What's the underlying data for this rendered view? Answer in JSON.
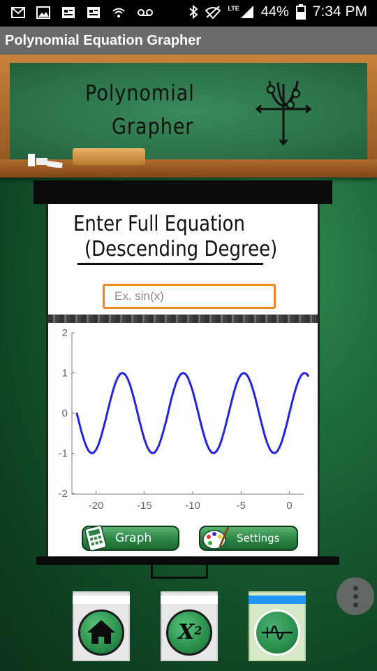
{
  "status_bar": {
    "battery": "44%",
    "time": "7:34 PM",
    "signal_label": "LTE",
    "notification_icons": [
      "gmail-icon",
      "gallery-icon",
      "news-icon",
      "news-icon",
      "wifi-icon",
      "voicemail-icon"
    ]
  },
  "app_bar": {
    "title": "Polynomial Equation Grapher"
  },
  "chalkboard": {
    "line1": "Polynomial",
    "line2": "Grapher"
  },
  "screen": {
    "prompt_line1": "Enter Full Equation",
    "prompt_line2": "(Descending Degree)",
    "input_placeholder": "Ex. sin(x)",
    "input_value": ""
  },
  "chart_data": {
    "type": "line",
    "function": "sin",
    "x": [
      -22.0,
      -21.75,
      -21.5,
      -21.25,
      -21.0,
      -20.75,
      -20.5,
      -20.25,
      -20.0,
      -19.75,
      -19.5,
      -19.25,
      -19.0,
      -18.75,
      -18.5,
      -18.25,
      -18.0,
      -17.75,
      -17.5,
      -17.25,
      -17.0,
      -16.75,
      -16.5,
      -16.25,
      -16.0,
      -15.75,
      -15.5,
      -15.25,
      -15.0,
      -14.75,
      -14.5,
      -14.25,
      -14.0,
      -13.75,
      -13.5,
      -13.25,
      -13.0,
      -12.75,
      -12.5,
      -12.25,
      -12.0,
      -11.75,
      -11.5,
      -11.25,
      -11.0,
      -10.75,
      -10.5,
      -10.25,
      -10.0,
      -9.75,
      -9.5,
      -9.25,
      -9.0,
      -8.75,
      -8.5,
      -8.25,
      -8.0,
      -7.75,
      -7.5,
      -7.25,
      -7.0,
      -6.75,
      -6.5,
      -6.25,
      -6.0,
      -5.75,
      -5.5,
      -5.25,
      -5.0,
      -4.75,
      -4.5,
      -4.25,
      -4.0,
      -3.75,
      -3.5,
      -3.25,
      -3.0,
      -2.75,
      -2.5,
      -2.25,
      -2.0,
      -1.75,
      -1.5,
      -1.25,
      -1.0,
      -0.75,
      -0.5,
      -0.25,
      0.0,
      0.25,
      0.5,
      0.75,
      1.0,
      1.25,
      1.5,
      1.75,
      2.0
    ],
    "y": [
      0.009,
      -0.238,
      -0.469,
      -0.67,
      -0.837,
      -0.946,
      -0.998,
      -0.987,
      -0.913,
      -0.783,
      -0.601,
      -0.38,
      -0.15,
      0.097,
      0.34,
      0.556,
      0.751,
      0.889,
      0.978,
      1.0,
      0.961,
      0.864,
      0.712,
      0.515,
      0.288,
      0.042,
      -0.207,
      -0.439,
      -0.65,
      -0.818,
      -0.935,
      -0.995,
      -0.991,
      -0.922,
      -0.803,
      -0.626,
      -0.42,
      -0.196,
      0.066,
      0.32,
      0.537,
      0.728,
      0.875,
      0.969,
      1.0,
      0.97,
      0.88,
      0.729,
      0.544,
      0.32,
      0.075,
      -0.174,
      -0.412,
      -0.621,
      -0.798,
      -0.922,
      -0.989,
      -0.995,
      -0.938,
      -0.825,
      -0.657,
      -0.447,
      -0.215,
      0.032,
      0.279,
      0.508,
      0.706,
      0.859,
      0.959,
      0.999,
      0.977,
      0.895,
      0.757,
      0.572,
      0.351,
      0.108,
      -0.141,
      -0.382,
      -0.598,
      -0.778,
      -0.909,
      -0.984,
      -0.997,
      -0.949,
      -0.841,
      -0.682,
      -0.479,
      -0.247,
      0.0,
      0.247,
      0.479,
      0.682,
      0.841,
      0.949,
      0.997,
      0.984,
      0.909
    ],
    "xlim": [
      -22.5,
      2.2
    ],
    "ylim": [
      -2,
      2
    ],
    "x_ticks": [
      -20,
      -15,
      -10,
      -5,
      0
    ],
    "y_ticks": [
      2,
      1,
      0,
      -1,
      -2
    ],
    "x_tick_labels": [
      "-20",
      "-15",
      "-10",
      "-5",
      "0"
    ],
    "y_tick_labels": [
      "2",
      "1",
      "0",
      "-1",
      "-2"
    ],
    "line_color": "#2323e0",
    "grid": false
  },
  "buttons": {
    "graph_label": "Graph",
    "settings_label": "Settings"
  },
  "bottom_nav": [
    {
      "name": "home",
      "icon": "home-icon",
      "selected": false
    },
    {
      "name": "power",
      "icon": "x-squared-icon",
      "label": "X",
      "superscript": "2",
      "selected": false
    },
    {
      "name": "graph",
      "icon": "waveform-icon",
      "selected": true,
      "accent": "#2196f3"
    }
  ]
}
